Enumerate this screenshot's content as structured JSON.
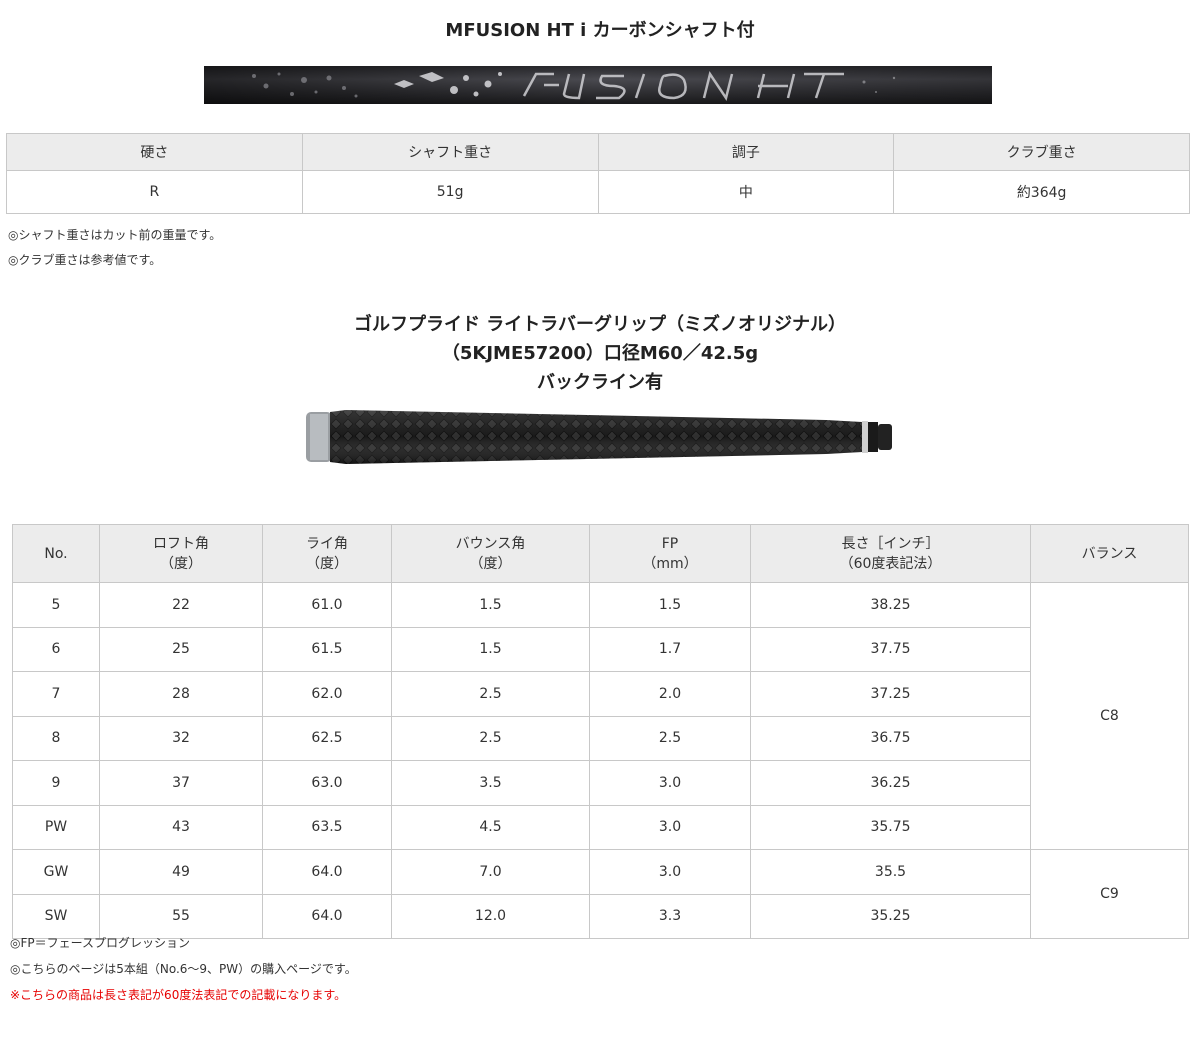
{
  "shaft": {
    "title": "MFUSION HT i カーボンシャフト付",
    "headers": [
      "硬さ",
      "シャフト重さ",
      "調子",
      "クラブ重さ"
    ],
    "values": [
      "R",
      "51g",
      "中",
      "約364g"
    ],
    "notes": [
      "◎シャフト重さはカット前の重量です。",
      "◎クラブ重さは参考値です。"
    ]
  },
  "grip": {
    "title_lines": [
      "ゴルフプライド ライトラバーグリップ（ミズノオリジナル）",
      "（5KJME57200）口径M60／42.5g",
      "バックライン有"
    ]
  },
  "spec": {
    "headers": {
      "no": "No.",
      "loft": "ロフト角",
      "loft_unit": "（度）",
      "lie": "ライ角",
      "lie_unit": "（度）",
      "bounce": "バウンス角",
      "bounce_unit": "（度）",
      "fp": "FP",
      "fp_unit": "（mm）",
      "length": "長さ［インチ］",
      "length_unit": "（60度表記法）",
      "balance": "バランス"
    },
    "rows": [
      [
        "5",
        "22",
        "61.0",
        "1.5",
        "1.5",
        "38.25"
      ],
      [
        "6",
        "25",
        "61.5",
        "1.5",
        "1.7",
        "37.75"
      ],
      [
        "7",
        "28",
        "62.0",
        "2.5",
        "2.0",
        "37.25"
      ],
      [
        "8",
        "32",
        "62.5",
        "2.5",
        "2.5",
        "36.75"
      ],
      [
        "9",
        "37",
        "63.0",
        "3.5",
        "3.0",
        "36.25"
      ],
      [
        "PW",
        "43",
        "63.5",
        "4.5",
        "3.0",
        "35.75"
      ],
      [
        "GW",
        "49",
        "64.0",
        "7.0",
        "3.0",
        "35.5"
      ],
      [
        "SW",
        "55",
        "64.0",
        "12.0",
        "3.3",
        "35.25"
      ]
    ],
    "balance": [
      "C8",
      "C9"
    ]
  },
  "footnotes": {
    "fp": "◎FP＝フェースプログレッション",
    "set": "◎こちらのページは5本組（No.6～9、PW）の購入ページです。",
    "warning": "※こちらの商品は長さ表記が60度法表記での記載になります。"
  },
  "colors": {
    "warning": "#e60000",
    "header_bg": "#ececec",
    "border": "#c8c8c8"
  }
}
